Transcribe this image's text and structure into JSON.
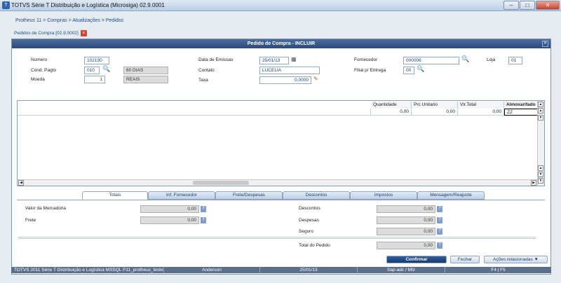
{
  "app": {
    "title": "TOTVS Série T Distribuição e Logística (Microsiga) 02.9.0001",
    "icon": "totvs-logo-icon"
  },
  "window_controls": {
    "minimize": "–",
    "maximize": "□",
    "close": "✕"
  },
  "breadcrumb": "Protheus 11 > Compras  > Atualizações > Pedidos",
  "frame_tab": "Pedidos de Compra [02.9.0002]",
  "dialog": {
    "title": "Pedido de Compra - INCLUIR",
    "fields": {
      "numero": {
        "label": "Numero",
        "value": "102130"
      },
      "cond_pagto": {
        "label": "Cond. Pagto",
        "value": "010",
        "desc": "60 DIAS"
      },
      "moeda": {
        "label": "Moeda",
        "value": "1",
        "desc": "REAIS"
      },
      "data_emissao": {
        "label": "Data de Emissao",
        "value": "25/01/13"
      },
      "contato": {
        "label": "Contato",
        "value": "LUCELIA"
      },
      "taxa": {
        "label": "Taxa",
        "value": "0,0000"
      },
      "fornecedor": {
        "label": "Fornecedor",
        "value": "000006"
      },
      "loja": {
        "label": "Loja",
        "value": "01"
      },
      "filial_entrega": {
        "label": "Filial p/ Entrega",
        "value": "00"
      }
    },
    "grid": {
      "headers": [
        "Quantidade",
        "Prc Unitario",
        "Vlr.Total",
        "Almoxarifado"
      ],
      "rows": [
        [
          "0,00",
          "0,00",
          "0,00",
          "ZZ"
        ]
      ]
    },
    "tabs": [
      "Totais",
      "Inf. Fornecedor",
      "Frete/Despesas",
      "Descontos",
      "Impostos",
      "Mensagem/Reajuste"
    ],
    "totals": {
      "valor_mercadoria": {
        "label": "Valor da Mercadoria",
        "value": "0,00"
      },
      "frete": {
        "label": "Frete",
        "value": "0,00"
      },
      "descontos": {
        "label": "Descontos",
        "value": "0,00"
      },
      "despesas": {
        "label": "Despesas",
        "value": "0,00"
      },
      "seguro": {
        "label": "Seguro",
        "value": "0,00"
      },
      "total_pedido": {
        "label": "Total do Pedido",
        "value": "0,00"
      }
    },
    "buttons": {
      "confirm": "Confirmar",
      "close": "Fechar",
      "related": "Ações relacionadas"
    }
  },
  "status": {
    "system": "TOTVS 2011 Série T Distribuição e Logística MSSQL P11_protheus_teste",
    "user": "Anderson",
    "date": "25/01/13",
    "env": "Sap-adc / Mtz",
    "keys": "F4 | F5"
  },
  "help_button": "?"
}
